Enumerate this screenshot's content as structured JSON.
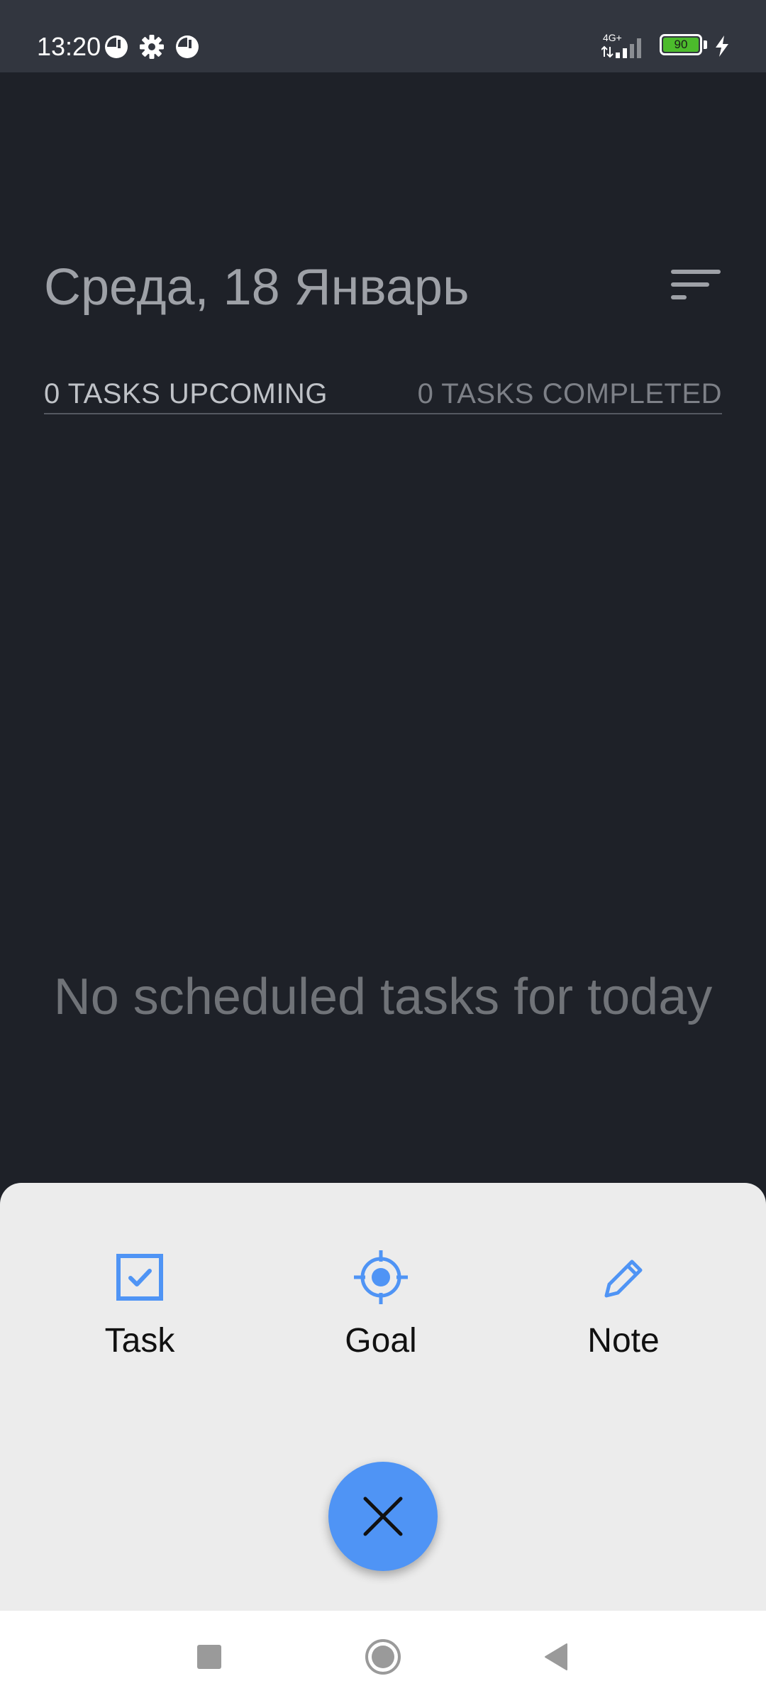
{
  "status_bar": {
    "time": "13:20",
    "network": "4G+",
    "battery": "90",
    "icons": [
      "pie-icon",
      "gear-icon",
      "pie-icon",
      "signal-icon",
      "battery-icon",
      "charging-icon"
    ]
  },
  "header": {
    "title": "Среда, 18 Январь",
    "filter_icon": "filter-lines-icon"
  },
  "tabs": {
    "upcoming": "0 TASKS UPCOMING",
    "completed": "0 TASKS COMPLETED"
  },
  "empty_state": {
    "message": "No scheduled tasks for today"
  },
  "add_sheet": {
    "options": [
      {
        "label": "Task",
        "icon": "checkbox-icon"
      },
      {
        "label": "Goal",
        "icon": "target-icon"
      },
      {
        "label": "Note",
        "icon": "pencil-icon"
      }
    ],
    "close_icon": "close-icon"
  },
  "nav_bar": {
    "buttons": [
      "recents-square-icon",
      "home-circle-icon",
      "back-triangle-icon"
    ]
  },
  "colors": {
    "background": "#1e2128",
    "status_bar": "#32363f",
    "sheet": "#ececec",
    "accent": "#4f94f5"
  }
}
